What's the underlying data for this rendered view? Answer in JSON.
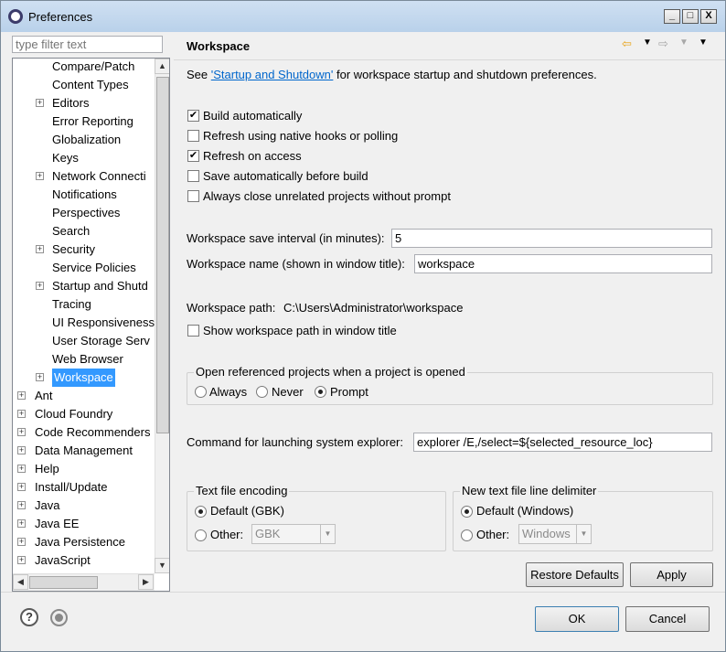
{
  "window": {
    "title": "Preferences"
  },
  "window_controls": {
    "minimize": "_",
    "maximize": "□",
    "close": "X"
  },
  "filter": {
    "placeholder": "type filter text"
  },
  "tree": {
    "items": [
      {
        "label": "Compare/Patch",
        "expandable": false
      },
      {
        "label": "Content Types",
        "expandable": false
      },
      {
        "label": "Editors",
        "expandable": true
      },
      {
        "label": "Error Reporting",
        "expandable": false
      },
      {
        "label": "Globalization",
        "expandable": false
      },
      {
        "label": "Keys",
        "expandable": false
      },
      {
        "label": "Network Connecti",
        "expandable": true
      },
      {
        "label": "Notifications",
        "expandable": false
      },
      {
        "label": "Perspectives",
        "expandable": false
      },
      {
        "label": "Search",
        "expandable": false
      },
      {
        "label": "Security",
        "expandable": true
      },
      {
        "label": "Service Policies",
        "expandable": false
      },
      {
        "label": "Startup and Shutd",
        "expandable": true
      },
      {
        "label": "Tracing",
        "expandable": false
      },
      {
        "label": "UI Responsiveness",
        "expandable": false
      },
      {
        "label": "User Storage Serv",
        "expandable": false
      },
      {
        "label": "Web Browser",
        "expandable": false
      },
      {
        "label": "Workspace",
        "expandable": true,
        "selected": true
      },
      {
        "label": "Ant",
        "expandable": true,
        "top": true
      },
      {
        "label": "Cloud Foundry",
        "expandable": true,
        "top": true
      },
      {
        "label": "Code Recommenders",
        "expandable": true,
        "top": true
      },
      {
        "label": "Data Management",
        "expandable": true,
        "top": true
      },
      {
        "label": "Help",
        "expandable": true,
        "top": true
      },
      {
        "label": "Install/Update",
        "expandable": true,
        "top": true
      },
      {
        "label": "Java",
        "expandable": true,
        "top": true
      },
      {
        "label": "Java EE",
        "expandable": true,
        "top": true
      },
      {
        "label": "Java Persistence",
        "expandable": true,
        "top": true
      },
      {
        "label": "JavaScript",
        "expandable": true,
        "top": true
      }
    ]
  },
  "page": {
    "title": "Workspace",
    "intro_prefix": "See ",
    "intro_link": "'Startup and Shutdown'",
    "intro_suffix": " for workspace startup and shutdown preferences.",
    "checkboxes": [
      {
        "label": "Build automatically",
        "checked": true
      },
      {
        "label": "Refresh using native hooks or polling",
        "checked": false
      },
      {
        "label": "Refresh on access",
        "checked": true
      },
      {
        "label": "Save automatically before build",
        "checked": false
      },
      {
        "label": "Always close unrelated projects without prompt",
        "checked": false
      }
    ],
    "save_interval_label": "Workspace save interval (in minutes):",
    "save_interval_value": "5",
    "workspace_name_label": "Workspace name (shown in window title):",
    "workspace_name_value": "workspace",
    "workspace_path_label": "Workspace path:",
    "workspace_path_value": "C:\\Users\\Administrator\\workspace",
    "show_path_label": "Show workspace path in window title",
    "open_ref_group": {
      "title": "Open referenced projects when a project is opened",
      "options": [
        "Always",
        "Never",
        "Prompt"
      ],
      "selected": "Prompt"
    },
    "command_label": "Command for launching system explorer:",
    "command_value": "explorer /E,/select=${selected_resource_loc}",
    "encoding_group": {
      "title": "Text file encoding",
      "default_label": "Default (GBK)",
      "other_label": "Other:",
      "other_value": "GBK"
    },
    "delimiter_group": {
      "title": "New text file line delimiter",
      "default_label": "Default (Windows)",
      "other_label": "Other:",
      "other_value": "Windows"
    },
    "restore_defaults": "Restore Defaults",
    "apply": "Apply"
  },
  "footer": {
    "ok": "OK",
    "cancel": "Cancel",
    "help_glyph": "?"
  }
}
